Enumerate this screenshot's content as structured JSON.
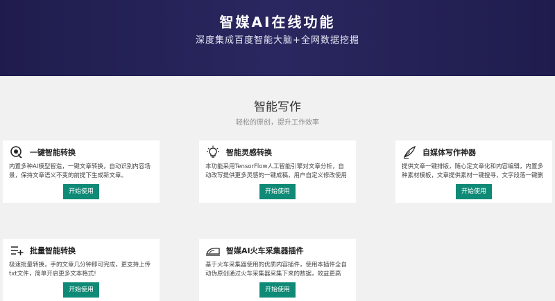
{
  "hero": {
    "title": "智媒AI在线功能",
    "subtitle": "深度集成百度智能大脑+全网数据挖掘"
  },
  "section": {
    "title": "智能写作",
    "subtitle": "轻松的原创，提升工作效率"
  },
  "cards": [
    {
      "title": "一键智能转换",
      "icon": "pointer-target-icon",
      "desc": "内置多种AI模型智造，一键文章转换，自动识别内容场景，保持文章语义不变的前提下生成新文章。",
      "button": "开始使用"
    },
    {
      "title": "智能灵感转换",
      "icon": "lightbulb-icon",
      "desc": "本功能采用TensorFlow人工智能引擎对文章分析，自动改写提供更多灵感的一键成稿，用户自定义修改使用",
      "button": "开始使用"
    },
    {
      "title": "自媒体写作神器",
      "icon": "quill-pen-icon",
      "desc": "提供文章一键排版，随心定文章化和内容编辑，内置多种素材模板，文章提供素材一键搜寻，文字段落一键删除控制",
      "button": "开始使用"
    },
    {
      "title": "批量智能转换",
      "icon": "batch-list-add-icon",
      "desc": "极速批量转换，手的文章几分钟即可完成，更支持上传txt文件，简单开启更多文本格式!",
      "button": "开始使用"
    },
    {
      "title": "智媒AI火车采集器插件",
      "icon": "train-icon",
      "desc": "基于火车采集器使用的优质内容插件，使用本插件全自动伪原创通过火车采集器采集下来的数据，效益更高",
      "button": "开始使用"
    }
  ]
}
